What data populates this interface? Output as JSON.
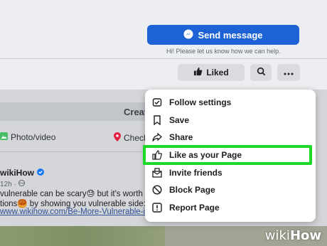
{
  "header": {
    "send_label": "Send message",
    "hint": "Hi! Please let us know how we can help.",
    "liked_label": "Liked"
  },
  "composer": {
    "create_label": "Create",
    "photo_label": "Photo/video",
    "check_label": "Check"
  },
  "post": {
    "author": "wikiHow",
    "meta": "12h · ",
    "line1": "vulnerable can be scary😓 but it's worth it!🥰 C",
    "line2": "tions🥮 by showing you vulnerable side:",
    "link": "www.wikihow.com/Be-More-Vulnerable-in-Re"
  },
  "menu": {
    "items": [
      {
        "label": "Follow settings",
        "icon": "follow-settings-icon"
      },
      {
        "label": "Save",
        "icon": "bookmark-icon"
      },
      {
        "label": "Share",
        "icon": "share-icon"
      },
      {
        "label": "Like as your Page",
        "icon": "thumbs-up-icon"
      },
      {
        "label": "Invite friends",
        "icon": "invite-icon"
      },
      {
        "label": "Block Page",
        "icon": "block-icon"
      },
      {
        "label": "Report Page",
        "icon": "report-icon"
      }
    ]
  },
  "watermark": {
    "part1": "wiki",
    "part2": "How"
  },
  "colors": {
    "accent": "#1d63d6",
    "highlight": "#1fd929"
  }
}
